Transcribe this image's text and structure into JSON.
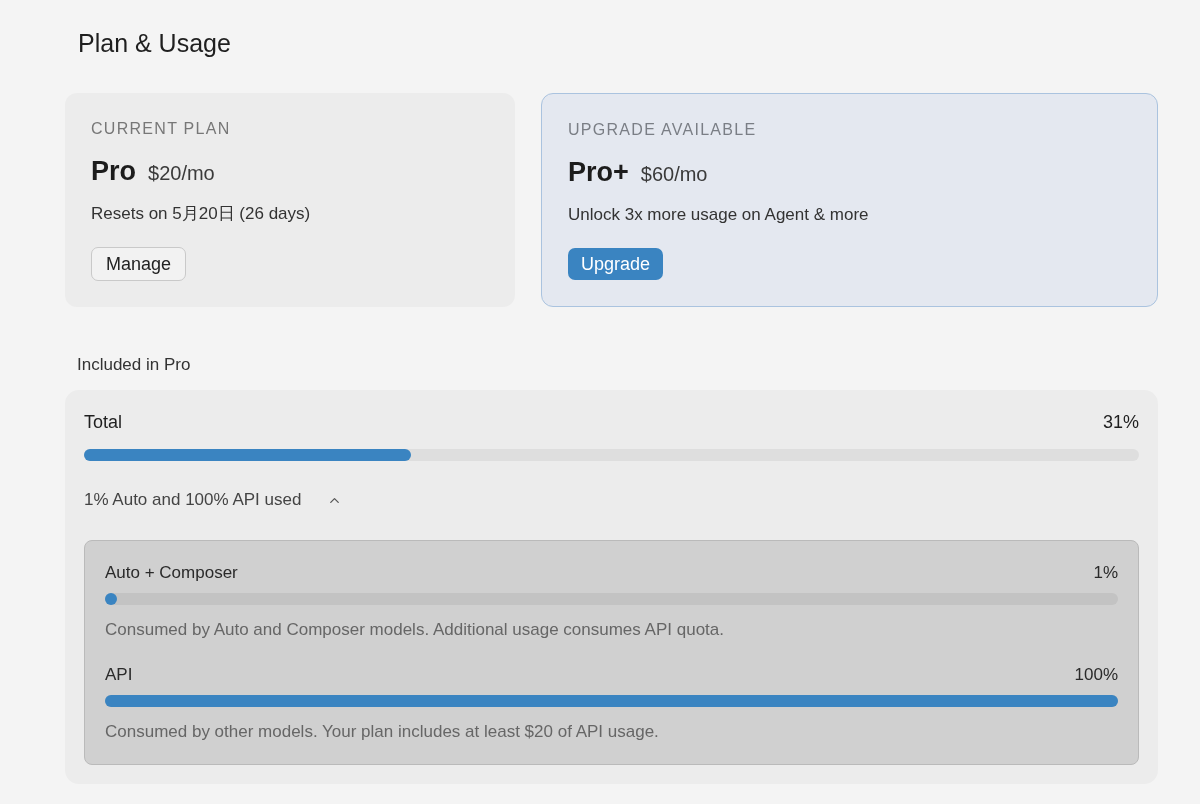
{
  "page": {
    "title": "Plan & Usage"
  },
  "plans": [
    {
      "kind": "current",
      "label": "CURRENT PLAN",
      "name": "Pro",
      "price": "$20/mo",
      "detail": "Resets on 5月20日 (26 days)",
      "button": "Manage"
    },
    {
      "kind": "upgrade",
      "label": "UPGRADE AVAILABLE",
      "name": "Pro+",
      "price": "$60/mo",
      "detail": "Unlock 3x more usage on Agent & more",
      "button": "Upgrade"
    }
  ],
  "usage": {
    "heading": "Included in Pro",
    "total": {
      "label": "Total",
      "reading": "31%",
      "level": 0.31
    },
    "breakdown": {
      "summary": "1% Auto and 100% API used",
      "expanded": true,
      "items": [
        {
          "label": "Auto + Composer",
          "reading": "1%",
          "level": 0.01,
          "description": "Consumed by Auto and Composer models. Additional usage consumes API quota."
        },
        {
          "label": "API",
          "reading": "100%",
          "level": 1.0,
          "description": "Consumed by other models. Your plan includes at least $20 of API usage."
        }
      ]
    }
  }
}
